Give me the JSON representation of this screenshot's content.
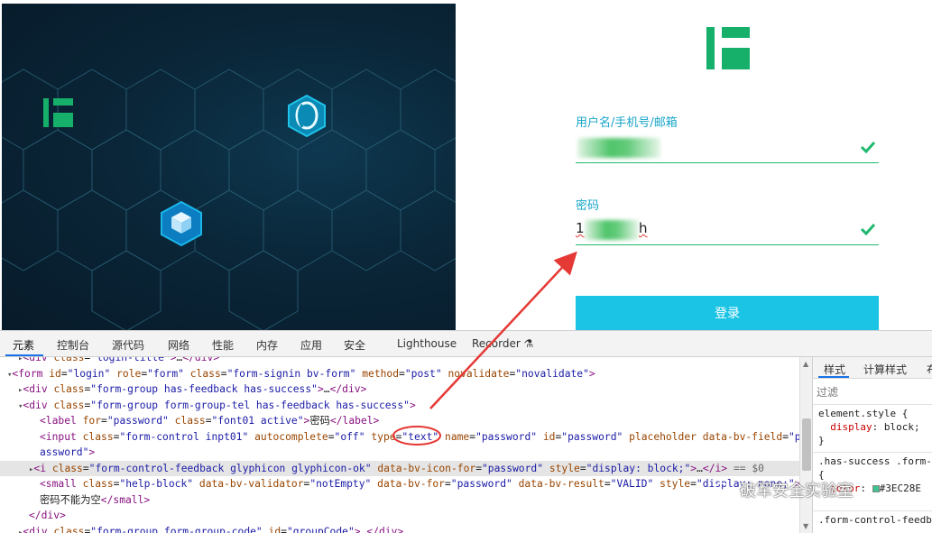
{
  "login": {
    "username_label": "用户名/手机号/邮箱",
    "password_label": "密码",
    "password_prefix": "1",
    "password_suffix": "h",
    "login_button": "登录",
    "accent_color": "#1bc4e4",
    "brand_color": "#16b06a"
  },
  "devtools": {
    "tabs": [
      "元素",
      "控制台",
      "源代码",
      "网络",
      "性能",
      "内存",
      "应用",
      "安全",
      "Lighthouse",
      "Recorder"
    ],
    "active_tab": "元素",
    "code_lines": [
      {
        "indent": 1,
        "html": "<span class=\"tri\">▸</span><span class=\"tag\">&lt;div</span> <span class=\"attr\">class</span>=<span class=\"val\">\"login-title\"</span><span class=\"tag\">&gt;</span>…<span class=\"tag\">&lt;/div&gt;</span>"
      },
      {
        "indent": 0,
        "html": "<span class=\"tri\">▾</span><span class=\"tag\">&lt;form</span> <span class=\"attr\">id</span>=<span class=\"val\">\"login\"</span> <span class=\"attr\">role</span>=<span class=\"val\">\"form\"</span> <span class=\"attr\">class</span>=<span class=\"val\">\"form-signin bv-form\"</span> <span class=\"attr\">method</span>=<span class=\"val\">\"post\"</span> <span class=\"attr\">novalidate</span>=<span class=\"val\">\"novalidate\"</span><span class=\"tag\">&gt;</span>"
      },
      {
        "indent": 1,
        "html": "<span class=\"tri\">▸</span><span class=\"tag\">&lt;div</span> <span class=\"attr\">class</span>=<span class=\"val\">\"form-group has-feedback has-success\"</span><span class=\"tag\">&gt;</span>…<span class=\"tag\">&lt;/div&gt;</span>"
      },
      {
        "indent": 1,
        "html": "<span class=\"tri\">▾</span><span class=\"tag\">&lt;div</span> <span class=\"attr\">class</span>=<span class=\"val\">\"form-group form-group-tel has-feedback has-success\"</span><span class=\"tag\">&gt;</span>"
      },
      {
        "indent": 3,
        "html": "<span class=\"tag\">&lt;label</span> <span class=\"attr\">for</span>=<span class=\"val\">\"password\"</span> <span class=\"attr\">class</span>=<span class=\"val\">\"font01 active\"</span><span class=\"tag\">&gt;</span><span class=\"txt\">密码</span><span class=\"tag\">&lt;/label&gt;</span>"
      },
      {
        "indent": 3,
        "html": "<span class=\"tag\">&lt;input</span> <span class=\"attr\">class</span>=<span class=\"val\">\"form-control inpt01\"</span> <span class=\"attr\">autocomplete</span>=<span class=\"val\">\"off\"</span> <span class=\"attr\">type</span>=<span class=\"val\">\"text\"</span> <span class=\"attr\">name</span>=<span class=\"val\">\"password\"</span> <span class=\"attr\">id</span>=<span class=\"val\">\"password\"</span> <span class=\"attr\">placeholder</span> <span class=\"attr\">data-bv-field</span>=<span class=\"val\">\"p</span>"
      },
      {
        "indent": 3,
        "html": "<span class=\"val\">assword\"</span><span class=\"tag\">&gt;</span>"
      },
      {
        "indent": 2,
        "html": "<span class=\"tri\">▸</span><span class=\"tag\">&lt;i</span> <span class=\"attr\">class</span>=<span class=\"val\">\"form-control-feedback glyphicon glyphicon-ok\"</span> <span class=\"attr\">data-bv-icon-for</span>=<span class=\"val\">\"password\"</span> <span class=\"attr\">style</span>=<span class=\"val\">\"display: block;\"</span><span class=\"tag\">&gt;</span>…<span class=\"tag\">&lt;/i&gt;</span> <span class=\"cmt\">== $0</span>"
      },
      {
        "indent": 3,
        "html": "<span class=\"tag\">&lt;small</span> <span class=\"attr\">class</span>=<span class=\"val\">\"help-block\"</span> <span class=\"attr\">data-bv-validator</span>=<span class=\"val\">\"notEmpty\"</span> <span class=\"attr\">data-bv-for</span>=<span class=\"val\">\"password\"</span> <span class=\"attr\">data-bv-result</span>=<span class=\"val\">\"VALID\"</span> <span class=\"attr\">style</span>=<span class=\"val\">\"display: none;\"</span><span class=\"tag\">&gt;</span>"
      },
      {
        "indent": 3,
        "html": "<span class=\"txt\">密码不能为空</span><span class=\"tag\">&lt;/small&gt;</span>"
      },
      {
        "indent": 2,
        "html": "<span class=\"tag\">&lt;/div&gt;</span>"
      },
      {
        "indent": 1,
        "html": "<span class=\"tri\">▸</span><span class=\"tag\">&lt;div</span> <span class=\"attr\">class</span>=<span class=\"val\">\"form-group form-group-code\"</span> <span class=\"attr\">id</span>=<span class=\"val\">\"groupCode\"</span><span class=\"tag\">&gt;</span>…<span class=\"tag\">&lt;/div&gt;</span>"
      }
    ],
    "selected_line": 7,
    "styles_tabs": [
      "样式",
      "计算样式",
      "布"
    ],
    "filter_placeholder": "过滤",
    "rule1_selector": "element.style {",
    "rule1_prop": "display",
    "rule1_value": "block;",
    "rule1_close": "}",
    "rule2_selector": ".has-success .form-",
    "rule2_open": "{",
    "rule2_prop": "color",
    "rule2_value": "#3EC28E",
    "rule3_selector": ".form-control-feedb"
  },
  "watermark": "破军安全实验室"
}
